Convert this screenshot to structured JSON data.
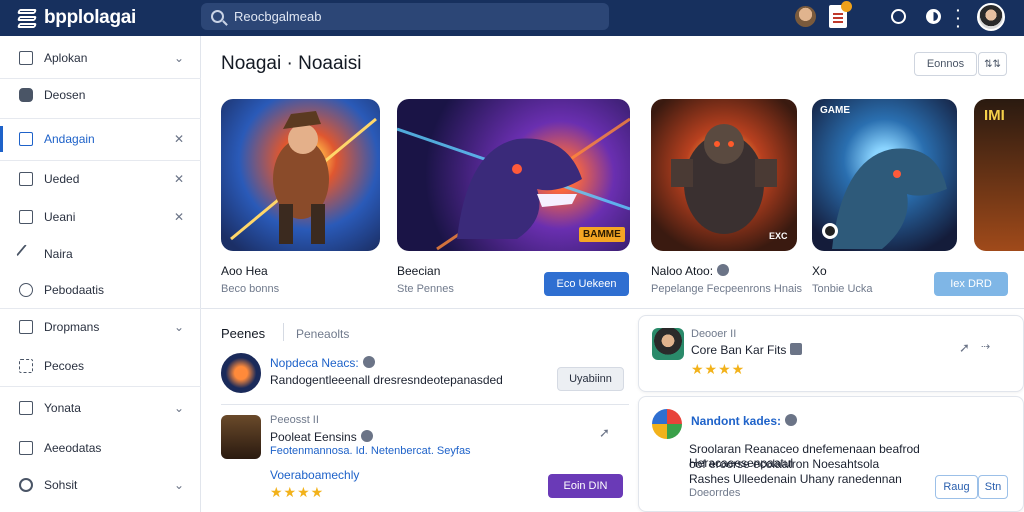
{
  "app": {
    "brand": "bpplolagai"
  },
  "search": {
    "placeholder": "Reocbgalmeab"
  },
  "sidebar": {
    "items": [
      {
        "label": "Aplokan",
        "right": "⌄",
        "icon": "home-icon"
      },
      {
        "label": "Deosen",
        "right": "",
        "icon": "gamepad-icon"
      },
      {
        "label": "Andagain",
        "right": "✕",
        "icon": "list-icon"
      },
      {
        "label": "Ueded",
        "right": "✕",
        "icon": "image-icon"
      },
      {
        "label": "Ueani",
        "right": "✕",
        "icon": "square-icon"
      },
      {
        "label": "Naira",
        "right": "",
        "icon": "pen-icon"
      },
      {
        "label": "Pebodaatis",
        "right": "",
        "icon": "badge-icon"
      },
      {
        "label": "Dropmans",
        "right": "⌄",
        "icon": "list-icon"
      },
      {
        "label": "Pecoes",
        "right": "",
        "icon": "puzzle-icon"
      },
      {
        "label": "Yonata",
        "right": "⌄",
        "icon": "gift-icon"
      },
      {
        "label": "Aeeodatas",
        "right": "",
        "icon": "file-icon"
      },
      {
        "label": "Sohsit",
        "right": "⌄",
        "icon": "gear-icon"
      }
    ]
  },
  "header": {
    "title": "Noagai · Noaaisi",
    "sort_label": "Eonnos",
    "filter_label": "⇅⇅"
  },
  "cards": [
    {
      "title": "Aoo Hea",
      "sub": "Beco bonns",
      "image_badge": ""
    },
    {
      "title": "Beecian",
      "sub": "Ste  Pennes",
      "button": "Eco  Uekeen",
      "image_badge": "BAMME"
    },
    {
      "title": "Naloo Atoo:",
      "sub": "Pepelange Fecpeenrons Hnais",
      "image_badge": "EXC"
    },
    {
      "title": "Xo",
      "sub": "Tonbie Ucka",
      "button": "Iex  DRD",
      "image_badge": "GAME"
    },
    {
      "title": "",
      "sub": "",
      "image_badge": "IMI"
    }
  ],
  "list": {
    "tab_active": "Peenes",
    "tab_inactive": "Peneaolts",
    "items": [
      {
        "title": "Nopdeca Neacs:",
        "desc": "Randogentleeenall dresresndeotepanasded",
        "button": "Uyabiinn"
      },
      {
        "meta": "Peeosst  II",
        "title": "Pooleat Eensins",
        "desc": "Feotenmannosa. Id. Netenbercat. Seyfas",
        "highlight": "Voeraboamechly",
        "rating": "★★★★",
        "button": "Eoin  DIN"
      }
    ]
  },
  "panels": [
    {
      "meta": "Deooer  II",
      "title": "Core Ban Kar Fits",
      "rating": "★★★★"
    },
    {
      "title": "Nandont kades:",
      "lines": [
        "Sroolaran Reanaceo dnefemenaan beafrod Heracaeesenpaatul",
        "oof eroorse ecolaatron Noesahtsola",
        "Rashes Ulleedenain Uhany ranedennan"
      ],
      "footer": "Doeorrdes",
      "btn1": "Raug",
      "btn2": "Stn"
    }
  ],
  "colors": {
    "topbar": "#17305e",
    "accent": "#1e62c9",
    "purple": "#6a3ab7",
    "star": "#f2b21b"
  }
}
